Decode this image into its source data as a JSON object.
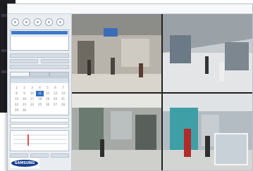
{
  "app": {
    "title": "",
    "logo_text": "SAMSUNG"
  },
  "menu": {
    "items": [
      "",
      "",
      "",
      "",
      ""
    ],
    "active_index": 3
  },
  "calendar": {
    "days": [
      "1",
      "2",
      "3",
      "4",
      "5",
      "6",
      "7",
      "8",
      "9",
      "10",
      "11",
      "12",
      "13",
      "14",
      "15",
      "16",
      "17",
      "18",
      "19",
      "20",
      "21",
      "22",
      "23",
      "24",
      "25",
      "26",
      "27",
      "28",
      "29",
      "30"
    ],
    "selected_index": 10
  },
  "cameras": [
    {
      "id": "cam-1"
    },
    {
      "id": "cam-2"
    },
    {
      "id": "cam-3"
    },
    {
      "id": "cam-4"
    }
  ],
  "colors": {
    "accent": "#f08030",
    "selection": "#2f6fc0",
    "brand": "#1a3f8f"
  }
}
